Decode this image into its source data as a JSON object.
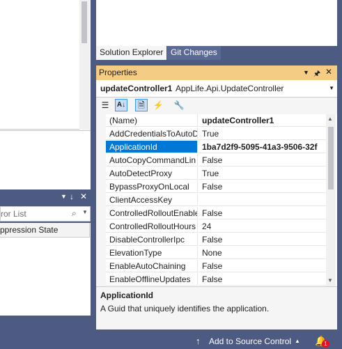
{
  "error_list": {
    "search_placeholder": "ror List",
    "column_header": "ppression State",
    "pin_glyph": "↓",
    "close_glyph": "✕",
    "dropdown_glyph": "▼"
  },
  "solution_tabs": [
    {
      "label": "Solution Explorer",
      "active": true
    },
    {
      "label": "Git Changes",
      "active": false
    }
  ],
  "properties": {
    "title": "Properties",
    "object_name": "updateController1",
    "object_type": "AppLife.Api.UpdateController",
    "rows": [
      {
        "name": "(Name)",
        "value": "updateController1",
        "bold": true
      },
      {
        "name": "AddCredentialsToAutoD",
        "value": "True"
      },
      {
        "name": "ApplicationId",
        "value": "1ba7d2f9-5095-41a3-9506-32f",
        "bold": true,
        "selected": true
      },
      {
        "name": "AutoCopyCommandLin",
        "value": "False"
      },
      {
        "name": "AutoDetectProxy",
        "value": "True"
      },
      {
        "name": "BypassProxyOnLocal",
        "value": "False"
      },
      {
        "name": "ClientAccessKey",
        "value": ""
      },
      {
        "name": "ControlledRolloutEnable",
        "value": "False"
      },
      {
        "name": "ControlledRolloutHours",
        "value": "24"
      },
      {
        "name": "DisableControllerIpc",
        "value": "False"
      },
      {
        "name": "ElevationType",
        "value": "None"
      },
      {
        "name": "EnableAutoChaining",
        "value": "False"
      },
      {
        "name": "EnableOfflineUpdates",
        "value": "False"
      }
    ],
    "description_name": "ApplicationId",
    "description_text": "A Guid that uniquely identifies the application."
  },
  "status_bar": {
    "source_control_label": "Add to Source Control",
    "notification_count": "1"
  },
  "colors": {
    "chrome": "#4d5a82",
    "title_highlight": "#f5cc84",
    "selection": "#0078d7"
  }
}
